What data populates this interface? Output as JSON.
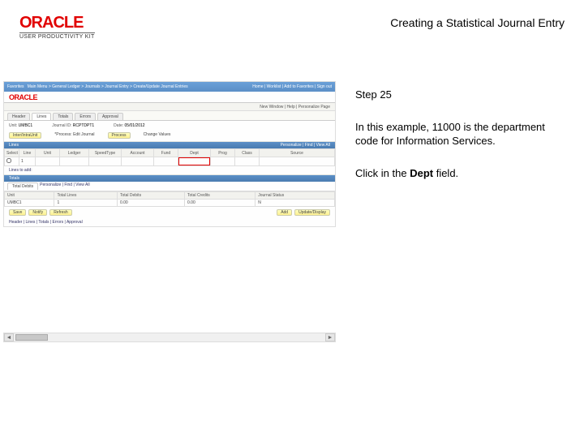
{
  "header": {
    "logo_text": "ORACLE",
    "logo_sub": "USER PRODUCTIVITY KIT",
    "title": "Creating a Statistical Journal Entry"
  },
  "instructions": {
    "step_label": "Step 25",
    "body": "In this example, 11000 is the department code for Information Services.",
    "action_pre": "Click in the ",
    "action_field": "Dept",
    "action_post": " field."
  },
  "mock": {
    "brand": "ORACLE",
    "breadcrumb": "New Window | Help | Personalize Page",
    "tabs": [
      "Header",
      "Lines",
      "Totals",
      "Errors",
      "Approval"
    ],
    "form": {
      "unit_lbl": "Unit:",
      "unit_val": "UMBC1",
      "jid_lbl": "Journal ID:",
      "jid_val": "RCPTDPT1",
      "date_lbl": "Date:",
      "date_val": "05/01/2012"
    },
    "row2": {
      "btn1": "Inter/IntraUnit",
      "proc_lbl": "*Process:",
      "proc_val": "Edit Journal",
      "btn2": "Process",
      "chg_lbl": "Change Values"
    },
    "lines_hdr_left": "Lines",
    "lines_hdr_right": "Personalize | Find | View All",
    "grid": {
      "cols": [
        "Select",
        "Line",
        "Unit",
        "Ledger",
        "SpeedType",
        "Account",
        "Fund",
        "Dept",
        "Prog",
        "Class",
        "Source"
      ],
      "row": [
        "",
        "1",
        "",
        "",
        "",
        "",
        "",
        "",
        "",
        "",
        ""
      ]
    },
    "search_lbl": "Lines to add:",
    "totals_hdr": "Totals",
    "totals_right": "Personalize | Find | View All",
    "totals_tabs": [
      "Total Debits"
    ],
    "totals_grid": {
      "cols": [
        "Unit",
        "Total Lines",
        "Total Debits",
        "Total Credits",
        "Journal Status"
      ],
      "row": [
        "UMBC1",
        "1",
        "0.00",
        "0.00",
        "N"
      ]
    },
    "footer": {
      "save": "Save",
      "notify": "Notify",
      "refresh": "Refresh",
      "add": "Add",
      "update": "Update/Display"
    },
    "links": "Header | Lines | Totals | Errors | Approval"
  }
}
